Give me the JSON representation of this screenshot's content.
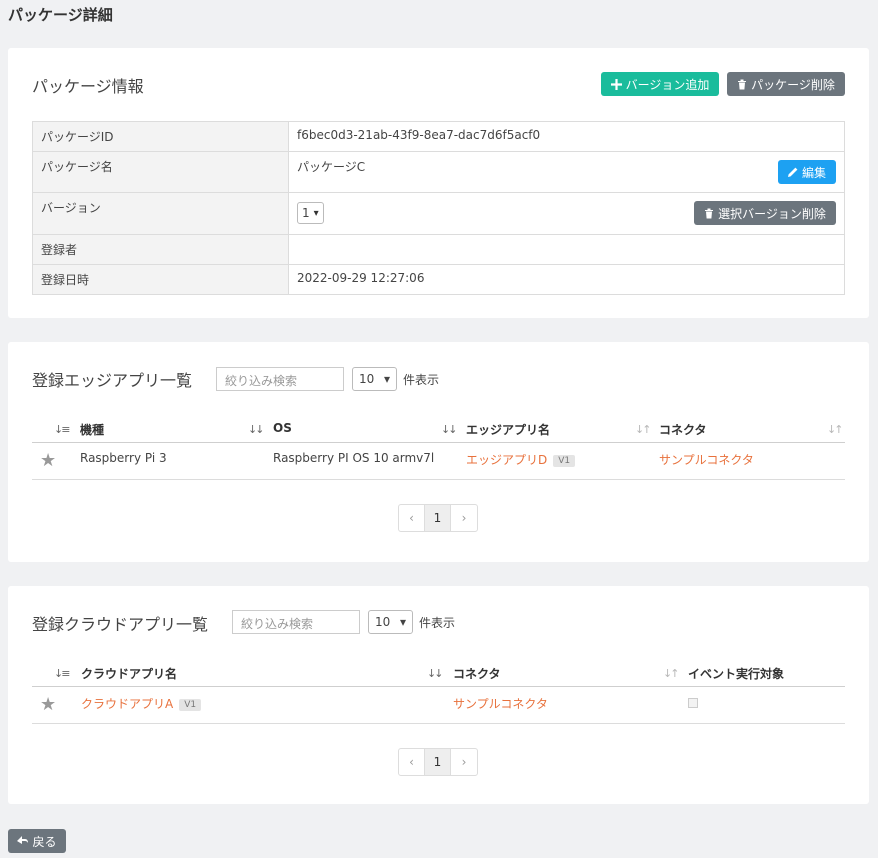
{
  "page": {
    "title": "パッケージ詳細"
  },
  "package_info": {
    "title": "パッケージ情報",
    "add_version_label": "バージョン追加",
    "delete_package_label": "パッケージ削除",
    "rows": {
      "id": {
        "label": "パッケージID",
        "value": "f6bec0d3-21ab-43f9-8ea7-dac7d6f5acf0"
      },
      "name": {
        "label": "パッケージ名",
        "value": "パッケージC",
        "edit_label": "編集"
      },
      "version": {
        "label": "バージョン",
        "selected": "1",
        "delete_label": "選択バージョン削除"
      },
      "registrant": {
        "label": "登録者",
        "value": ""
      },
      "registered_at": {
        "label": "登録日時",
        "value": "2022-09-29 12:27:06"
      }
    }
  },
  "edge_apps": {
    "title": "登録エッジアプリ一覧",
    "search_placeholder": "絞り込み検索",
    "per_page": "10",
    "per_page_label": "件表示",
    "columns": [
      "機種",
      "OS",
      "エッジアプリ名",
      "コネクタ"
    ],
    "rows": [
      {
        "model": "Raspberry Pi 3",
        "os": "Raspberry PI OS 10 armv7l",
        "app": "エッジアプリD",
        "version": "V1",
        "connector": "サンプルコネクタ"
      }
    ],
    "pager": {
      "prev": "‹",
      "current": "1",
      "next": "›"
    }
  },
  "cloud_apps": {
    "title": "登録クラウドアプリ一覧",
    "search_placeholder": "絞り込み検索",
    "per_page": "10",
    "per_page_label": "件表示",
    "columns": [
      "クラウドアプリ名",
      "コネクタ",
      "イベント実行対象"
    ],
    "rows": [
      {
        "app": "クラウドアプリA",
        "version": "V1",
        "connector": "サンプルコネクタ"
      }
    ],
    "pager": {
      "prev": "‹",
      "current": "1",
      "next": "›"
    }
  },
  "footer": {
    "back_label": "戻る"
  },
  "colors": {
    "accent_teal": "#1abc9c",
    "link_orange": "#e8713c",
    "button_gray": "#6c757d",
    "edit_blue": "#1da1f2"
  }
}
